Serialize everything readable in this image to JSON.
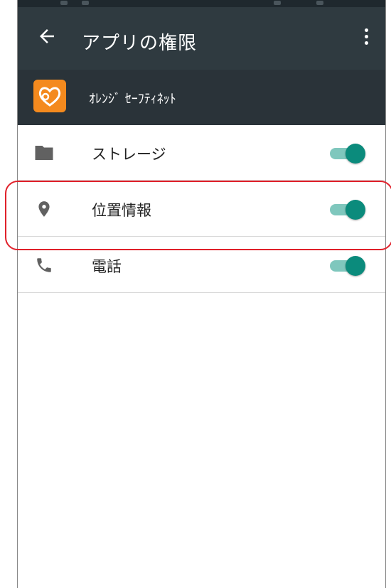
{
  "appbar": {
    "title": "アプリの権限",
    "back_icon": "arrow-left-icon",
    "more_icon": "more-vert-icon"
  },
  "app": {
    "name": "ｵﾚﾝｼﾞ ｾｰﾌﾃｨﾈｯﾄ",
    "logo_icon": "heart-logo-icon",
    "logo_color": "#f48a1e"
  },
  "permissions": [
    {
      "label": "ストレージ",
      "icon": "folder-icon",
      "enabled": true
    },
    {
      "label": "位置情報",
      "icon": "location-pin-icon",
      "enabled": true
    },
    {
      "label": "電話",
      "icon": "phone-icon",
      "enabled": true
    }
  ],
  "colors": {
    "appbar": "#2f3a40",
    "switch_on_thumb": "#0b8b7c",
    "switch_on_track": "#7fc7bd",
    "highlight": "#e0202a"
  }
}
